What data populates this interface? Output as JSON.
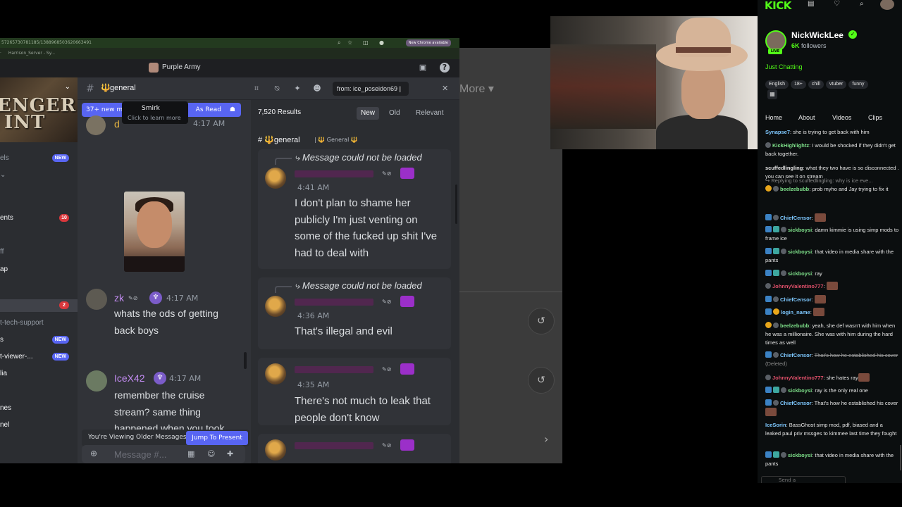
{
  "browser": {
    "url_fragment": "57265730781185/1388968503620663491",
    "bookmark_1": "Harrison_Server - Sy...",
    "new_chrome": "New Chrome available"
  },
  "discord": {
    "server_name": "Purple Army",
    "banner_text": "ENGER\nINT",
    "channel": {
      "name": "general",
      "emoji": "🔱"
    },
    "search": {
      "query": "from: ice_poseidon69"
    },
    "sidebar": {
      "items": [
        {
          "label": "els",
          "badge": "NEW"
        },
        {
          "label": "⌄",
          "badge": ""
        },
        {
          "label": "ents",
          "badge": "10"
        },
        {
          "label": "ff",
          "badge": ""
        },
        {
          "label": "ap",
          "badge": ""
        },
        {
          "label": "",
          "badge": "2"
        },
        {
          "label": "t-tech-support",
          "badge": ""
        },
        {
          "label": "s",
          "badge": "NEW"
        },
        {
          "label": "t-viewer-...",
          "badge": "NEW"
        },
        {
          "label": "lia",
          "badge": ""
        },
        {
          "label": "nes",
          "badge": ""
        },
        {
          "label": "nel",
          "badge": ""
        }
      ]
    },
    "new_bar": {
      "left": "37+ new m",
      "right": "As Read"
    },
    "tooltip": {
      "title": "Smirk",
      "subtitle": "Click to learn more"
    },
    "messages": [
      {
        "author": "d",
        "time": "4:17 AM"
      },
      {
        "author": "zk",
        "time": "4:17 AM",
        "text": "whats the ods of getting back boys"
      },
      {
        "author": "IceX42",
        "time": "4:17 AM",
        "text": "remember the cruise stream? same thing happened when you took her phone, she got super sketchy and"
      }
    ],
    "older_bar": {
      "label": "You're Viewing Older Messages",
      "button": "Jump To Present"
    },
    "composer": {
      "placeholder": "Message #..."
    },
    "results": {
      "count": "7,520 Results",
      "sort_tabs": [
        "New",
        "Old",
        "Relevant"
      ],
      "active_sort": "New",
      "channel_label": "general",
      "category_label": "General",
      "items": [
        {
          "reply": "Message could not be loaded",
          "time": "4:41 AM",
          "text": "I don't plan to shame her publicly I'm just venting on some of the fucked up shit I've had to deal with"
        },
        {
          "reply": "Message could not be loaded",
          "time": "4:36 AM",
          "text": "That's illegal and evil"
        },
        {
          "reply": "",
          "time": "4:35 AM",
          "text": "There's not much to leak that people don't know"
        }
      ]
    }
  },
  "background_app": {
    "more_label": "More",
    "chevron": "›"
  },
  "kick": {
    "logo": "KICK",
    "streamer": "NickWickLee",
    "live_label": "LIVE",
    "followers_count": "6K",
    "followers_label": "followers",
    "category": "Just Chatting",
    "tags": [
      "English",
      "18+",
      "chill",
      "vtuber",
      "funny"
    ],
    "tabs": [
      "Home",
      "About",
      "Videos",
      "Clips"
    ],
    "chat": [
      {
        "user": "Synapse7",
        "color": "#7ec8ff",
        "text": "she is trying to get back with him",
        "badges": []
      },
      {
        "user": "KickHighlightz",
        "color": "#7ee08a",
        "text": "I would be shocked if they didn't get back together.",
        "badges": [
          "dot"
        ]
      },
      {
        "user": "scuffedlingling",
        "color": "#e6e6e6",
        "text": "what they two have is so disconnected . you can see it on stream",
        "badges": []
      },
      {
        "user": "beelzebubb",
        "color": "#7ee08a",
        "text": "prob myho and Jay trying to fix it",
        "badges": [
          "sub",
          "dot"
        ],
        "reply": "Replying to scuffedlingling: why is ice eve..."
      },
      {
        "user": "ChiefCensor",
        "color": "#7ec8ff",
        "text": "",
        "badges": [
          "mod",
          "dot"
        ],
        "emote": true
      },
      {
        "user": "sickboysi",
        "color": "#7ee08a",
        "text": "damn kimmie is using simp mods to frame ice",
        "badges": [
          "mod",
          "vip",
          "dot"
        ]
      },
      {
        "user": "sickboysi",
        "color": "#7ee08a",
        "text": "that video in media share with the pants",
        "badges": [
          "mod",
          "vip",
          "dot"
        ]
      },
      {
        "user": "sickboysi",
        "color": "#7ee08a",
        "text": "ray",
        "badges": [
          "mod",
          "vip",
          "dot"
        ]
      },
      {
        "user": "JohnnyValentino777",
        "color": "#e0506a",
        "text": "",
        "badges": [
          "dot"
        ],
        "emote": true
      },
      {
        "user": "ChiefCensor",
        "color": "#7ec8ff",
        "text": "",
        "badges": [
          "mod",
          "dot"
        ],
        "emote": true
      },
      {
        "user": "login_name",
        "color": "#7ec8ff",
        "text": "",
        "badges": [
          "mod",
          "sub"
        ],
        "emote": true
      },
      {
        "user": "beelzebubb",
        "color": "#7ee08a",
        "text": "yeah, she def wasn't with him when he was a millionaire. She was with him during the hard times as well",
        "badges": [
          "sub",
          "dot"
        ]
      },
      {
        "user": "ChiefCensor",
        "color": "#7ec8ff",
        "text": "That's how he established his cover",
        "badges": [
          "mod",
          "dot"
        ],
        "deleted": "(Deleted)"
      },
      {
        "user": "JohnnyValentino777",
        "color": "#e0506a",
        "text": "she hates ray",
        "badges": [
          "dot"
        ],
        "emote": true
      },
      {
        "user": "sickboysi",
        "color": "#7ee08a",
        "text": "ray is the only real one",
        "badges": [
          "mod",
          "vip",
          "dot"
        ]
      },
      {
        "user": "ChiefCensor",
        "color": "#7ec8ff",
        "text": "That's how he established his cover",
        "badges": [
          "mod",
          "dot"
        ],
        "emote": true
      },
      {
        "user": "IceSorin",
        "color": "#7ec8ff",
        "text": "BassGhost simp mod, pdf, biased and a leaked paul priv mssges to kimmee last time they fought",
        "badges": []
      },
      {
        "user": "sickboysi",
        "color": "#7ee08a",
        "text": "that video in media share with the pants",
        "badges": [
          "mod",
          "vip",
          "dot"
        ]
      }
    ],
    "send_placeholder": "Send a"
  }
}
